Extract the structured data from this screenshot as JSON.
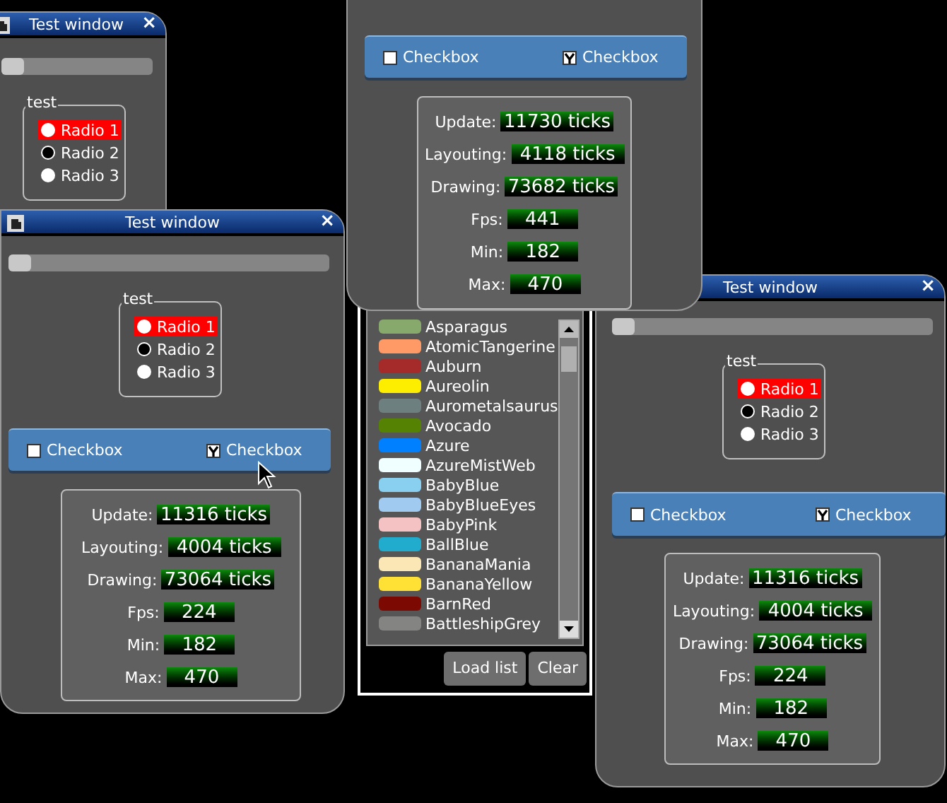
{
  "windows": [
    {
      "title": "Test window",
      "close": "×",
      "slider": {
        "level": 0
      },
      "radio_group": {
        "title": "test",
        "radios": [
          {
            "label": "Radio 1",
            "highlighted": true,
            "checked": false
          },
          {
            "label": "Radio 2",
            "highlighted": false,
            "checked": true
          },
          {
            "label": "Radio 3",
            "highlighted": false,
            "checked": false
          }
        ]
      }
    },
    {
      "title": "Test window",
      "close": "×",
      "slider": {
        "level": 0
      },
      "radio_group": {
        "title": "test",
        "radios": [
          {
            "label": "Radio 1",
            "highlighted": true,
            "checked": false
          },
          {
            "label": "Radio 2",
            "highlighted": false,
            "checked": true
          },
          {
            "label": "Radio 3",
            "highlighted": false,
            "checked": false
          }
        ]
      },
      "checkboxes": [
        {
          "label": "Checkbox",
          "checked": false
        },
        {
          "label": "Checkbox",
          "checked": true
        }
      ],
      "stats": [
        {
          "label": "Update:",
          "value": "11316 ticks",
          "kind": "ticks"
        },
        {
          "label": "Layouting:",
          "value": "4004 ticks",
          "kind": "ticks"
        },
        {
          "label": "Drawing:",
          "value": "73064 ticks",
          "kind": "ticks"
        },
        {
          "label": "Fps:",
          "value": "224",
          "kind": "count"
        },
        {
          "label": "Min:",
          "value": "182",
          "kind": "count"
        },
        {
          "label": "Max:",
          "value": "470",
          "kind": "count"
        }
      ]
    },
    {
      "title": "Test window",
      "close": "×",
      "slider": {
        "level": 0
      },
      "radio_group": {
        "title": "test",
        "radios": [
          {
            "label": "Radio 1",
            "highlighted": true,
            "checked": false
          },
          {
            "label": "Radio 2",
            "highlighted": false,
            "checked": true
          },
          {
            "label": "Radio 3",
            "highlighted": false,
            "checked": false
          }
        ]
      },
      "checkboxes": [
        {
          "label": "Checkbox",
          "checked": false
        },
        {
          "label": "Checkbox",
          "checked": true
        }
      ],
      "stats": [
        {
          "label": "Update:",
          "value": "11316 ticks",
          "kind": "ticks"
        },
        {
          "label": "Layouting:",
          "value": "4004 ticks",
          "kind": "ticks"
        },
        {
          "label": "Drawing:",
          "value": "73064 ticks",
          "kind": "ticks"
        },
        {
          "label": "Fps:",
          "value": "224",
          "kind": "count"
        },
        {
          "label": "Min:",
          "value": "182",
          "kind": "count"
        },
        {
          "label": "Max:",
          "value": "470",
          "kind": "count"
        }
      ]
    },
    {
      "checkboxes": [
        {
          "label": "Checkbox",
          "checked": false
        },
        {
          "label": "Checkbox",
          "checked": true
        }
      ],
      "stats": [
        {
          "label": "Update:",
          "value": "11730 ticks",
          "kind": "ticks"
        },
        {
          "label": "Layouting:",
          "value": "4118 ticks",
          "kind": "ticks"
        },
        {
          "label": "Drawing:",
          "value": "73682 ticks",
          "kind": "ticks"
        },
        {
          "label": "Fps:",
          "value": "441",
          "kind": "count"
        },
        {
          "label": "Min:",
          "value": "182",
          "kind": "count"
        },
        {
          "label": "Max:",
          "value": "470",
          "kind": "count"
        }
      ]
    }
  ],
  "list_window": {
    "items": [
      {
        "name": "Asparagus",
        "color": "#87a96b"
      },
      {
        "name": "AtomicTangerine",
        "color": "#ff9966"
      },
      {
        "name": "Auburn",
        "color": "#a52a2a"
      },
      {
        "name": "Aureolin",
        "color": "#fdee00"
      },
      {
        "name": "Aurometalsaurus",
        "color": "#6e7f80"
      },
      {
        "name": "Avocado",
        "color": "#568203"
      },
      {
        "name": "Azure",
        "color": "#007fff"
      },
      {
        "name": "AzureMistWeb",
        "color": "#f0ffff"
      },
      {
        "name": "BabyBlue",
        "color": "#89cff0"
      },
      {
        "name": "BabyBlueEyes",
        "color": "#a1caf1"
      },
      {
        "name": "BabyPink",
        "color": "#f4c2c2"
      },
      {
        "name": "BallBlue",
        "color": "#21abcd"
      },
      {
        "name": "BananaMania",
        "color": "#fae7b5"
      },
      {
        "name": "BananaYellow",
        "color": "#ffe135"
      },
      {
        "name": "BarnRed",
        "color": "#7c0a02"
      },
      {
        "name": "BattleshipGrey",
        "color": "#848482"
      }
    ],
    "buttons": [
      "Load list",
      "Clear"
    ]
  }
}
